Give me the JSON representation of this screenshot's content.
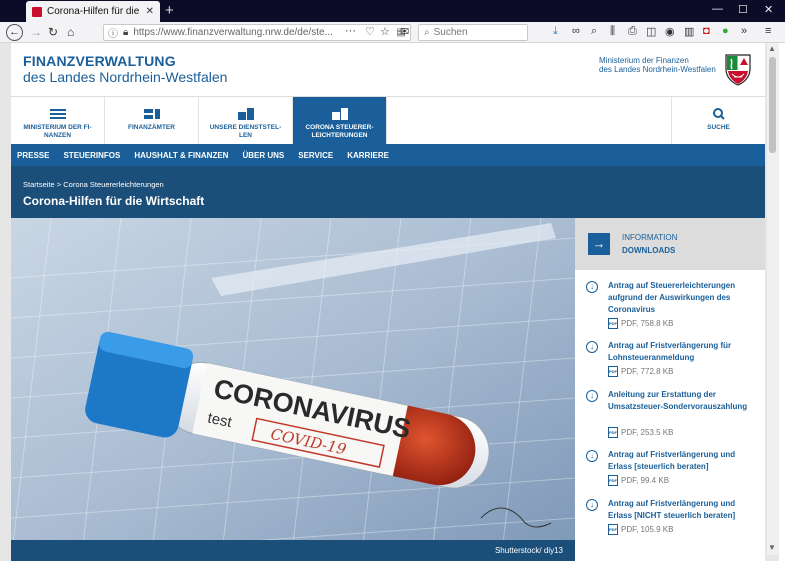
{
  "browser": {
    "tab_title": "Corona-Hilfen für die Wirtschaft",
    "url": "https://www.finanzverwaltung.nrw.de/de/ste...",
    "search_placeholder": "Suchen"
  },
  "header": {
    "title_line1": "FINANZVERWALTUNG",
    "title_line2": "des Landes Nordrhein-Westfalen",
    "ministry_line1": "Ministerium der Finanzen",
    "ministry_line2": "des Landes Nordrhein-Westfalen"
  },
  "main_nav": [
    {
      "label": "MINISTERIUM DER FI-NANZEN"
    },
    {
      "label": "FINANZÄMTER"
    },
    {
      "label": "UNSERE DIENSTSTEL-LEN"
    },
    {
      "label": "CORONA STEUERER-LEICHTERUNGEN"
    }
  ],
  "search_label": "SUCHE",
  "sub_nav": [
    "PRESSE",
    "STEUERINFOS",
    "HAUSHALT & FINANZEN",
    "ÜBER UNS",
    "SERVICE",
    "KARRIERE"
  ],
  "breadcrumb": "Startseite > Corona Steuererleichterungen",
  "page_title": "Corona-Hilfen für die Wirtschaft",
  "hero": {
    "word": "CORONAVIRUS",
    "test": "test",
    "covid": "COVID-19",
    "caption": "Shutterstock/ diy13"
  },
  "info": {
    "heading1": "INFORMATION",
    "heading2": "DOWNLOADS",
    "downloads": [
      {
        "title": "Antrag auf Steuererleichterungen aufgrund der Auswirkungen des Coronavirus",
        "meta": "PDF, 758.8 KB"
      },
      {
        "title": "Antrag auf Fristverlängerung für Lohnsteueranmeldung",
        "meta": "PDF, 772.8 KB"
      },
      {
        "title": "Anleitung zur Erstattung der Umsatzsteuer-Sondervorauszahlung",
        "meta": "PDF, 253.5 KB"
      },
      {
        "title": "Antrag auf Fristverlängerung und Erlass [steuerlich beraten]",
        "meta": "PDF, 99.4 KB"
      },
      {
        "title": "Antrag auf Fristverlängerung und Erlass [NICHT steuerlich beraten]",
        "meta": "PDF, 105.9 KB"
      }
    ]
  },
  "colors": {
    "brand": "#1a5f99",
    "band": "#1b4e79"
  }
}
